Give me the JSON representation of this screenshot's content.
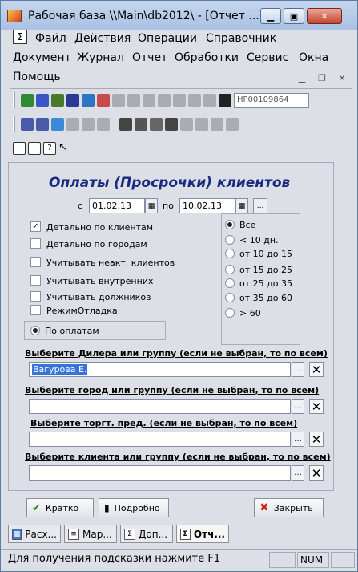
{
  "window": {
    "title": "Рабочая база \\\\Main\\db2012\\ - [Отчет ..."
  },
  "menu_row1": [
    {
      "label": "Файл"
    },
    {
      "label": "Действия"
    },
    {
      "label": "Операции"
    },
    {
      "label": "Справочник"
    }
  ],
  "menu_row2": [
    {
      "label": "Документ"
    },
    {
      "label": "Журнал"
    },
    {
      "label": "Отчет"
    },
    {
      "label": "Обработки"
    },
    {
      "label": "Сервис"
    },
    {
      "label": "Окна"
    }
  ],
  "menu_row3": [
    {
      "label": "Помощь"
    }
  ],
  "toolbar": {
    "search_value": "НР00109864"
  },
  "form": {
    "title": "Оплаты (Просрочки) клиентов",
    "date_from_label": "с",
    "date_from": "01.02.13",
    "date_to_label": "по",
    "date_to": "10.02.13",
    "date_more": "...",
    "checkboxes": [
      {
        "label": "Детально по клиентам",
        "checked": true,
        "mark": "✓"
      },
      {
        "label": "Детально по городам",
        "checked": false,
        "mark": ""
      },
      {
        "label": "Учитывать неакт. клиентов",
        "checked": false,
        "mark": ""
      },
      {
        "label": "Учитывать внутренних",
        "checked": false,
        "mark": ""
      },
      {
        "label": "Учитывать должников",
        "checked": false,
        "mark": ""
      },
      {
        "label": "РежимОтладка",
        "checked": false,
        "mark": ""
      }
    ],
    "periods": [
      {
        "label": "Все",
        "selected": true
      },
      {
        "label": "< 10 дн.",
        "selected": false
      },
      {
        "label": "от 10 до 15",
        "selected": false
      },
      {
        "label": "от 15 до 25",
        "selected": false
      },
      {
        "label": "от 25 до 35",
        "selected": false
      },
      {
        "label": "от 35 до 60",
        "selected": false
      },
      {
        "label": "> 60",
        "selected": false
      }
    ],
    "by_payments_label": "По оплатам",
    "selectors": [
      {
        "label": "Выберите Дилера или группу (если не выбран, то по всем)",
        "value": "Вагурова Е."
      },
      {
        "label": "Выберите город или группу (если не выбран, то по всем)",
        "value": ""
      },
      {
        "label": "Выберите торгт. пред. (если не выбран, то по всем)",
        "value": ""
      },
      {
        "label": "Выберите клиента или группу (если не выбран, то по всем)",
        "value": ""
      }
    ],
    "dots": "...",
    "clear": "✕",
    "btn_brief": "Кратко",
    "btn_detail": "Подробно",
    "btn_close": "Закрыть"
  },
  "tabs": [
    {
      "label": "Расх..."
    },
    {
      "label": "Мар..."
    },
    {
      "label": "Доп..."
    },
    {
      "label": "Отч..."
    }
  ],
  "status": {
    "hint": "Для получения подсказки нажмите F1",
    "num": "NUM"
  }
}
